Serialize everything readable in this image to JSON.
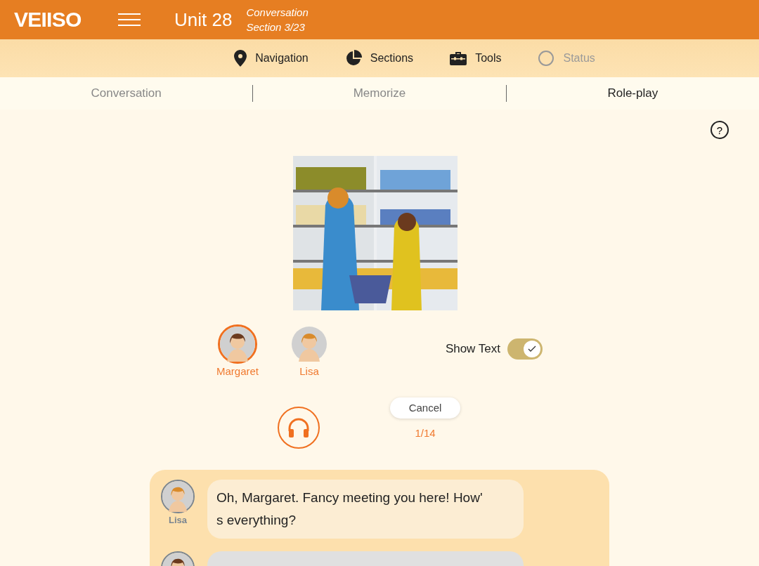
{
  "header": {
    "logo": "VEIISO",
    "unit": "Unit 28",
    "subtitle_1": "Conversation",
    "subtitle_2": "Section 3/23"
  },
  "nav": [
    {
      "label": "Navigation",
      "disabled": false
    },
    {
      "label": "Sections",
      "disabled": false
    },
    {
      "label": "Tools",
      "disabled": false
    },
    {
      "label": "Status",
      "disabled": true
    }
  ],
  "tabs": [
    {
      "label": "Conversation",
      "selected": false
    },
    {
      "label": "Memorize",
      "selected": false
    },
    {
      "label": "Role-play",
      "selected": true
    }
  ],
  "help": "?",
  "characters": [
    {
      "name": "Margaret",
      "selected": true
    },
    {
      "name": "Lisa",
      "selected": false
    }
  ],
  "show_text": {
    "label": "Show Text",
    "on": true
  },
  "cancel": "Cancel",
  "progress": "1/14",
  "messages": [
    {
      "name": "Lisa",
      "text": "Oh, Margaret. Fancy meeting you here! How'\ns everything?",
      "revealed": true
    },
    {
      "revealed": false
    }
  ]
}
